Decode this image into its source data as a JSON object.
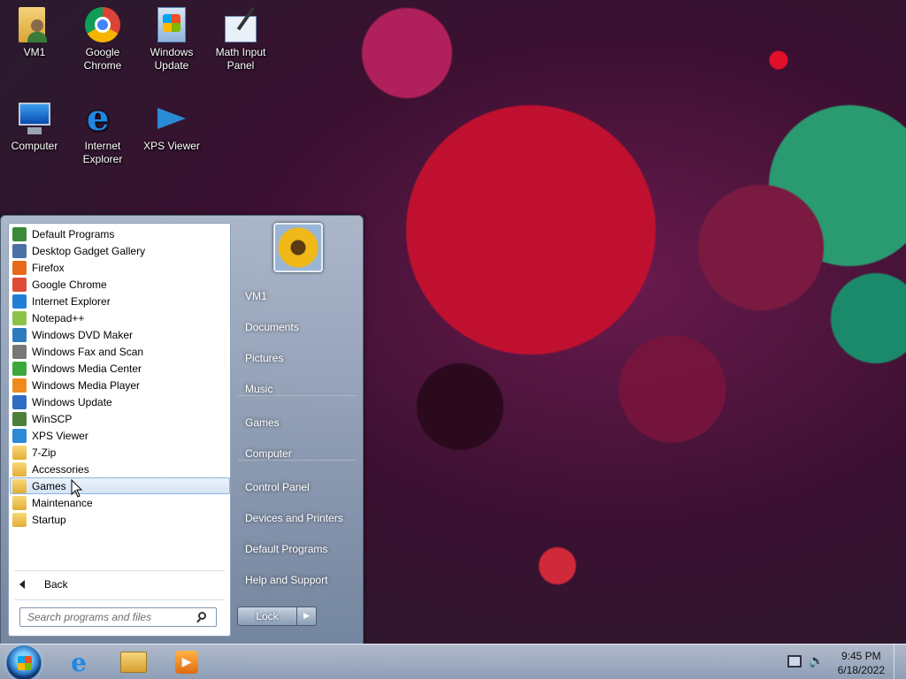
{
  "desktop": {
    "icons": [
      {
        "label": "VM1",
        "icon": "user-folder-icon"
      },
      {
        "label": "Google Chrome",
        "icon": "chrome-icon"
      },
      {
        "label": "Windows Update",
        "icon": "windows-update-icon"
      },
      {
        "label": "Math Input Panel",
        "icon": "math-input-icon"
      },
      {
        "label": "Computer",
        "icon": "computer-icon"
      },
      {
        "label": "Internet Explorer",
        "icon": "ie-icon"
      },
      {
        "label": "XPS Viewer",
        "icon": "xps-viewer-icon"
      }
    ]
  },
  "start_menu": {
    "programs": [
      {
        "label": "Default Programs",
        "icon": "default-programs-icon",
        "color": "#3a8a3a"
      },
      {
        "label": "Desktop Gadget Gallery",
        "icon": "gadget-icon",
        "color": "#4c6fa5"
      },
      {
        "label": "Firefox",
        "icon": "firefox-icon",
        "color": "#e66a1a"
      },
      {
        "label": "Google Chrome",
        "icon": "chrome-icon",
        "color": "#dd4b39"
      },
      {
        "label": "Internet Explorer",
        "icon": "ie-icon",
        "color": "#1f7fd8"
      },
      {
        "label": "Notepad++",
        "icon": "notepadpp-icon",
        "color": "#8bc34a"
      },
      {
        "label": "Windows DVD Maker",
        "icon": "dvd-maker-icon",
        "color": "#2c7bbf"
      },
      {
        "label": "Windows Fax and Scan",
        "icon": "fax-icon",
        "color": "#777777"
      },
      {
        "label": "Windows Media Center",
        "icon": "media-center-icon",
        "color": "#3aa83a"
      },
      {
        "label": "Windows Media Player",
        "icon": "media-player-icon",
        "color": "#f08a1c"
      },
      {
        "label": "Windows Update",
        "icon": "windows-update-icon",
        "color": "#2d6cc2"
      },
      {
        "label": "WinSCP",
        "icon": "winscp-icon",
        "color": "#4b7f3a"
      },
      {
        "label": "XPS Viewer",
        "icon": "xps-viewer-icon",
        "color": "#2a8ad6"
      },
      {
        "label": "7-Zip",
        "icon": "folder-icon",
        "folder": true
      },
      {
        "label": "Accessories",
        "icon": "folder-icon",
        "folder": true
      },
      {
        "label": "Games",
        "icon": "folder-icon",
        "folder": true,
        "highlighted": true
      },
      {
        "label": "Maintenance",
        "icon": "folder-icon",
        "folder": true
      },
      {
        "label": "Startup",
        "icon": "folder-icon",
        "folder": true
      }
    ],
    "back_label": "Back",
    "search_placeholder": "Search programs and files",
    "right_links": [
      {
        "label": "VM1"
      },
      {
        "label": "Documents"
      },
      {
        "label": "Pictures"
      },
      {
        "label": "Music"
      },
      {
        "label": "Games"
      },
      {
        "label": "Computer"
      },
      {
        "label": "Control Panel"
      },
      {
        "label": "Devices and Printers"
      },
      {
        "label": "Default Programs"
      },
      {
        "label": "Help and Support"
      }
    ],
    "lock_label": "Lock"
  },
  "taskbar": {
    "pinned": [
      {
        "icon": "ie-icon"
      },
      {
        "icon": "explorer-icon"
      },
      {
        "icon": "media-player-icon"
      }
    ],
    "time": "9:45 PM",
    "date": "6/18/2022"
  }
}
